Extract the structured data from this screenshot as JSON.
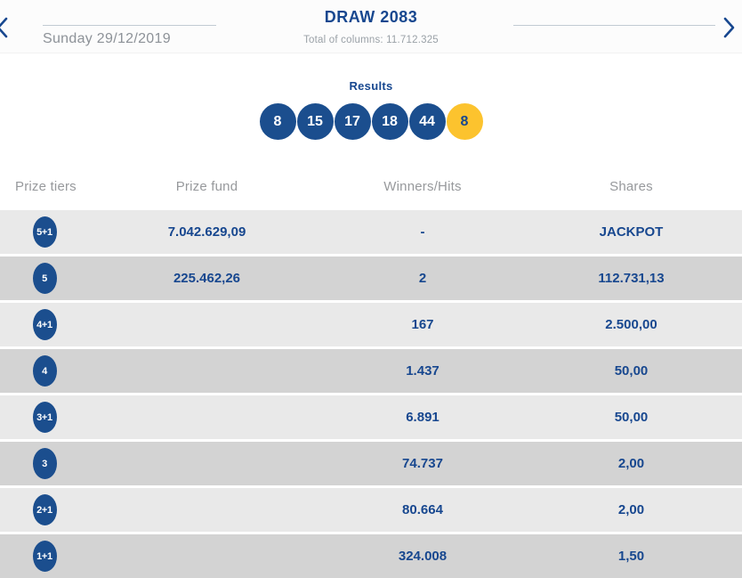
{
  "header": {
    "date": "Sunday 29/12/2019",
    "draw_title": "DRAW 2083",
    "total_label": "Total of columns: 11.712.325"
  },
  "results": {
    "label": "Results",
    "numbers": [
      "8",
      "15",
      "17",
      "18",
      "44"
    ],
    "bonus": "8"
  },
  "table": {
    "headers": [
      "Prize tiers",
      "Prize fund",
      "Winners/Hits",
      "Shares"
    ],
    "rows": [
      {
        "tier": "5+1",
        "prize_fund": "7.042.629,09",
        "winners": "-",
        "shares": "JACKPOT"
      },
      {
        "tier": "5",
        "prize_fund": "225.462,26",
        "winners": "2",
        "shares": "112.731,13"
      },
      {
        "tier": "4+1",
        "prize_fund": "",
        "winners": "167",
        "shares": "2.500,00"
      },
      {
        "tier": "4",
        "prize_fund": "",
        "winners": "1.437",
        "shares": "50,00"
      },
      {
        "tier": "3+1",
        "prize_fund": "",
        "winners": "6.891",
        "shares": "50,00"
      },
      {
        "tier": "3",
        "prize_fund": "",
        "winners": "74.737",
        "shares": "2,00"
      },
      {
        "tier": "2+1",
        "prize_fund": "",
        "winners": "80.664",
        "shares": "2,00"
      },
      {
        "tier": "1+1",
        "prize_fund": "",
        "winners": "324.008",
        "shares": "1,50"
      }
    ]
  },
  "colors": {
    "primary_blue": "#17478f",
    "ball_blue": "#1b4e8e",
    "bonus_yellow": "#fcc32e",
    "row_light": "#e9e9e9",
    "row_dark": "#d3d3d3",
    "gray_text": "#97999c",
    "line": "#c2cbd3"
  }
}
